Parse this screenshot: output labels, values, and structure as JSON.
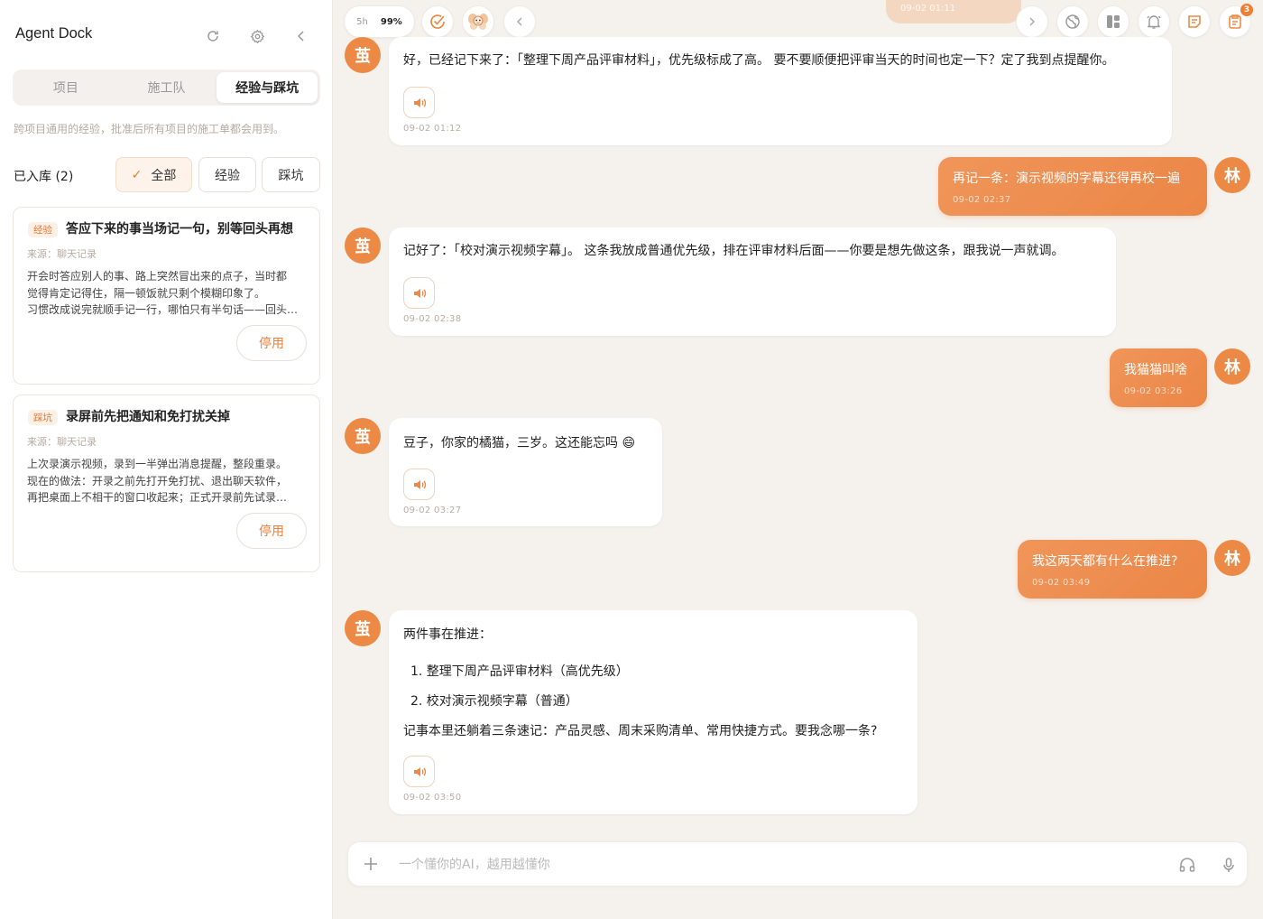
{
  "sidebar": {
    "title": "Agent Dock",
    "tabs": [
      {
        "label": "项目"
      },
      {
        "label": "施工队"
      },
      {
        "label": "经验与踩坑"
      }
    ],
    "description": "跨项目通用的经验，批准后所有项目的施工单都会用到。",
    "filter_label": "已入库 (2)",
    "filters": [
      {
        "label": "全部"
      },
      {
        "label": "经验"
      },
      {
        "label": "踩坑"
      }
    ],
    "cards": [
      {
        "tag": "经验",
        "title": "答应下来的事当场记一句，别等回头再想",
        "source": "来源：聊天记录",
        "body_lines": [
          "开会时答应别人的事、路上突然冒出来的点子，当时都",
          "觉得肯定记得住，隔一顿饭就只剩个模糊印象了。",
          "习惯改成说完就顺手记一行，哪怕只有半句话——回头…"
        ],
        "button": "停用"
      },
      {
        "tag": "踩坑",
        "title": "录屏前先把通知和免打扰关掉",
        "source": "来源：聊天记录",
        "body_lines": [
          "上次录演示视频，录到一半弹出消息提醒，整段重录。",
          "现在的做法：开录之前先打开免打扰、退出聊天软件，",
          "再把桌面上不相干的窗口收起来；正式开录前先试录…"
        ],
        "button": "停用"
      }
    ]
  },
  "topbar": {
    "time_label": "5h",
    "battery_label": "99%",
    "ghost_timestamp": "09-02 01:11",
    "badge_count": "3",
    "icons": [
      "check-circle-icon",
      "mascot-icon",
      "chevron-left-icon",
      "chevron-right-icon",
      "globe-icon",
      "layout-icon",
      "bell-icon",
      "note-icon",
      "clipboard-icon"
    ],
    "accent_color": "#ec8a45"
  },
  "messages": [
    {
      "role": "assistant",
      "avatar": "茧",
      "text": "好，已经记下来了：「整理下周产品评审材料」，优先级标成了高。 要不要顺便把评审当天的时间也定一下？定了我到点提醒你。",
      "time": "09-02 01:12"
    },
    {
      "role": "user",
      "avatar": "林",
      "text": "再记一条：演示视频的字幕还得再校一遍",
      "time": "09-02 02:37"
    },
    {
      "role": "assistant",
      "avatar": "茧",
      "text": "记好了：「校对演示视频字幕」。 这条我放成普通优先级，排在评审材料后面——你要是想先做这条，跟我说一声就调。",
      "time": "09-02 02:38"
    },
    {
      "role": "user",
      "avatar": "林",
      "text": "我猫猫叫啥",
      "time": "09-02 03:26"
    },
    {
      "role": "assistant",
      "avatar": "茧",
      "text": "豆子，你家的橘猫，三岁。这还能忘吗 😄",
      "time": "09-02 03:27"
    },
    {
      "role": "user",
      "avatar": "林",
      "text": "我这两天都有什么在推进?",
      "time": "09-02 03:49"
    },
    {
      "role": "assistant",
      "avatar": "茧",
      "intro": "两件事在推进：",
      "items": [
        "1. 整理下周产品评审材料（高优先级）",
        "2. 校对演示视频字幕（普通）"
      ],
      "outro": "记事本里还躺着三条速记：产品灵感、周末采购清单、常用快捷方式。要我念哪一条?",
      "time": "09-02 03:50"
    }
  ],
  "composer": {
    "placeholder": "一个懂你的AI，越用越懂你",
    "value": ""
  }
}
